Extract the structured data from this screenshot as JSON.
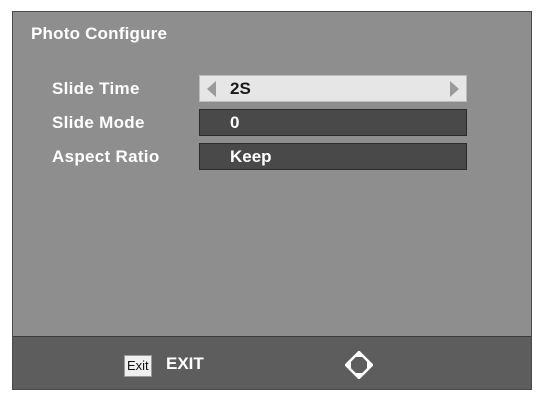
{
  "menu": {
    "title": "Photo Configure",
    "rows": [
      {
        "label": "Slide Time",
        "value": "2S",
        "selected": true
      },
      {
        "label": "Slide Mode",
        "value": "0",
        "selected": false
      },
      {
        "label": "Aspect Ratio",
        "value": "Keep",
        "selected": false
      }
    ]
  },
  "footer": {
    "exit_key": "Exit",
    "exit_label": "EXIT",
    "nav_icon": "navigation-diamond-icon"
  },
  "colors": {
    "panel_bg": "#8e8e8e",
    "footer_bg": "#5d5d5d",
    "selected_field_bg": "#e6e6e6",
    "field_bg": "#494949"
  }
}
